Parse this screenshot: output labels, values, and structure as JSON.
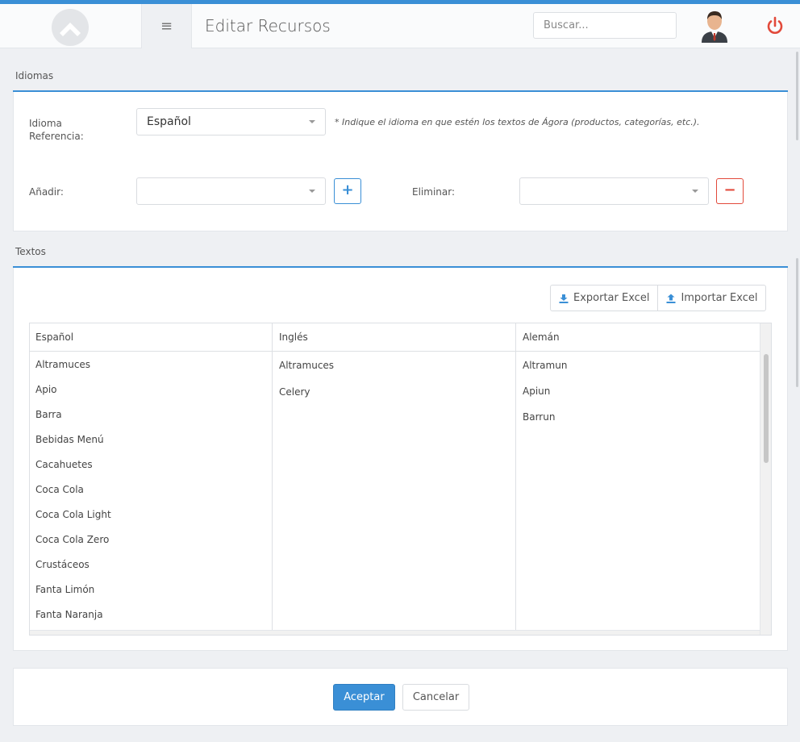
{
  "colors": {
    "accent": "#3a8fd6",
    "danger": "#e24a3b"
  },
  "header": {
    "title": "Editar Recursos",
    "search_placeholder": "Buscar...",
    "menu_icon": "hamburger-icon"
  },
  "idiomas": {
    "section_title": "Idiomas",
    "reference_label_line1": "Idioma",
    "reference_label_line2": "Referencia:",
    "reference_value": "Español",
    "hint": "* Indique el idioma en que estén los textos de Ágora (productos, categorías, etc.).",
    "add_label": "Añadir:",
    "add_value": "",
    "add_button": "+",
    "remove_label": "Eliminar:",
    "remove_value": "",
    "remove_button": "−"
  },
  "textos": {
    "section_title": "Textos",
    "export_label": "Exportar Excel",
    "import_label": "Importar Excel",
    "columns": [
      "Español",
      "Inglés",
      "Alemán"
    ],
    "col_es": [
      "Altramuces",
      "Apio",
      "Barra",
      "Bebidas Menú",
      "Cacahuetes",
      "Coca Cola",
      "Coca Cola Light",
      "Coca Cola Zero",
      "Crustáceos",
      "Fanta Limón",
      "Fanta Naranja"
    ],
    "col_en": [
      "Altramuces",
      "Celery"
    ],
    "col_de": [
      "Altramun",
      "Apiun",
      "Barrun"
    ]
  },
  "footer": {
    "accept_label": "Aceptar",
    "cancel_label": "Cancelar"
  }
}
